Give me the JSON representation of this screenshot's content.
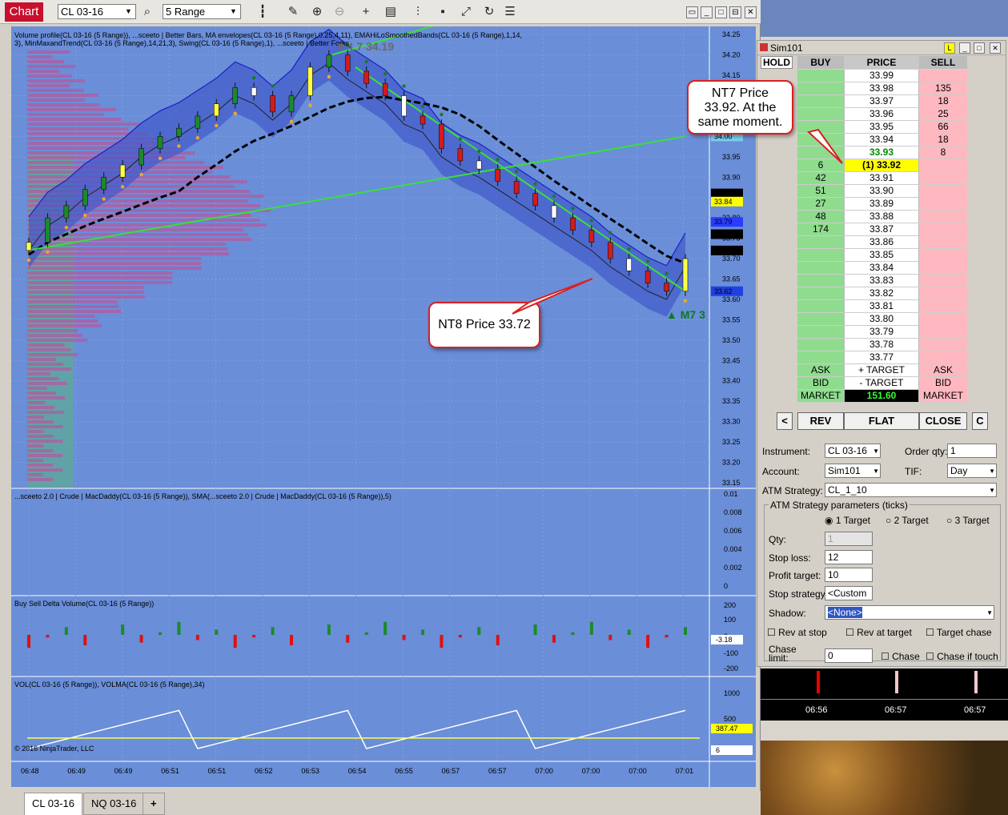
{
  "toolbar": {
    "chart_tab": "Chart",
    "instrument": "CL 03-16",
    "period": "5 Range"
  },
  "chart_data": {
    "type": "candlestick",
    "panels": [
      {
        "title": "Volume profile(CL 03-16 (5 Range)), ...sceeto | Better Bars, MA envelopes(CL 03-16 (5 Range),0.25,4,11), EMAHiLoSmoothedBands(CL 03-16 (5 Range),1,14,3), MinMaxandTrend(CL 03-16 (5 Range),14,21,3), Swing(CL 03-16 (5 Range),1), ...sceeto | Better Forks",
        "y_ticks": [
          "34.25",
          "34.20",
          "34.15",
          "34.10",
          "34.05",
          "34.00",
          "33.95",
          "33.90",
          "33.85",
          "33.80",
          "33.75",
          "33.70",
          "33.65",
          "33.60",
          "33.55",
          "33.50",
          "33.45",
          "33.40",
          "33.35",
          "33.30",
          "33.25",
          "33.20",
          "33.15"
        ],
        "price_flags": [
          "34.00",
          "33.86",
          "33.84",
          "33.79",
          "33.76",
          "33.72",
          "33.62"
        ],
        "annotations": [
          "L7  34.19",
          "M7  3"
        ]
      },
      {
        "title": "...sceeto 2.0 | Crude | MacDaddy(CL 03-16 (5 Range)), SMA(...sceeto 2.0 | Crude | MacDaddy(CL 03-16 (5 Range)),5)",
        "y_ticks": [
          "0.01",
          "0.008",
          "0.006",
          "0.004",
          "0.002",
          "0"
        ]
      },
      {
        "title": "Buy Sell Delta Volume(CL 03-16 (5 Range))",
        "y_ticks": [
          "200",
          "100",
          "0",
          "-100",
          "-200"
        ],
        "flag": "-3.18"
      },
      {
        "title": "VOL(CL 03-16 (5 Range)), VOLMA(CL 03-16 (5 Range),34)",
        "y_ticks": [
          "1000",
          "500"
        ],
        "flags": [
          "387.47",
          "6"
        ],
        "copyright": "© 2016 NinjaTrader, LLC"
      }
    ],
    "x_ticks": [
      "06:48",
      "06:49",
      "06:49",
      "06:51",
      "06:51",
      "06:52",
      "06:53",
      "06:54",
      "06:55",
      "06:57",
      "06:57",
      "07:00",
      "07:00",
      "07:00",
      "07:01"
    ],
    "candles": [
      33.74,
      33.8,
      33.83,
      33.87,
      33.9,
      33.93,
      33.97,
      34.0,
      34.02,
      34.05,
      34.08,
      34.12,
      34.1,
      34.06,
      34.1,
      34.17,
      34.2,
      34.16,
      34.13,
      34.1,
      34.05,
      34.03,
      33.97,
      33.94,
      33.92,
      33.89,
      33.86,
      33.83,
      33.8,
      33.77,
      33.74,
      33.7,
      33.67,
      33.64,
      33.62,
      33.7
    ]
  },
  "callouts": {
    "nt8": "NT8 Price 33.72",
    "nt7_1": "NT7 Price",
    "nt7_2": "33.92.  At the",
    "nt7_3": "same moment."
  },
  "bottom_tabs": [
    "CL 03-16",
    "NQ 03-16",
    "+"
  ],
  "sim": {
    "title": "Sim101",
    "headers": {
      "hold": "HOLD",
      "buy": "BUY",
      "price": "PRICE",
      "sell": "SELL"
    },
    "rows": [
      {
        "buy": "",
        "price": "33.99",
        "sell": ""
      },
      {
        "buy": "",
        "price": "33.98",
        "sell": "135"
      },
      {
        "buy": "",
        "price": "33.97",
        "sell": "18"
      },
      {
        "buy": "",
        "price": "33.96",
        "sell": "25"
      },
      {
        "buy": "",
        "price": "33.95",
        "sell": "66"
      },
      {
        "buy": "",
        "price": "33.94",
        "sell": "18"
      },
      {
        "buy": "",
        "price": "33.93",
        "sell": "8"
      },
      {
        "buy": "6",
        "price": "(1) 33.92",
        "sell": ""
      },
      {
        "buy": "42",
        "price": "33.91",
        "sell": ""
      },
      {
        "buy": "51",
        "price": "33.90",
        "sell": ""
      },
      {
        "buy": "27",
        "price": "33.89",
        "sell": ""
      },
      {
        "buy": "48",
        "price": "33.88",
        "sell": ""
      },
      {
        "buy": "174",
        "price": "33.87",
        "sell": ""
      },
      {
        "buy": "",
        "price": "33.86",
        "sell": ""
      },
      {
        "buy": "",
        "price": "33.85",
        "sell": ""
      },
      {
        "buy": "",
        "price": "33.84",
        "sell": ""
      },
      {
        "buy": "",
        "price": "33.83",
        "sell": ""
      },
      {
        "buy": "",
        "price": "33.82",
        "sell": ""
      },
      {
        "buy": "",
        "price": "33.81",
        "sell": ""
      },
      {
        "buy": "",
        "price": "33.80",
        "sell": ""
      },
      {
        "buy": "",
        "price": "33.79",
        "sell": ""
      },
      {
        "buy": "",
        "price": "33.78",
        "sell": ""
      },
      {
        "buy": "",
        "price": "33.77",
        "sell": ""
      },
      {
        "buy": "ASK",
        "price": "+ TARGET",
        "sell": "ASK"
      },
      {
        "buy": "BID",
        "price": "- TARGET",
        "sell": "BID"
      },
      {
        "buy": "MARKET",
        "price": "151.60",
        "sell": "MARKET"
      }
    ],
    "buttons": {
      "left": "<",
      "rev": "REV",
      "flat": "FLAT",
      "close": "CLOSE",
      "right": "C"
    },
    "labels": {
      "instrument": "Instrument:",
      "order_qty": "Order qty:",
      "account": "Account:",
      "tif": "TIF:",
      "atm": "ATM Strategy:",
      "atm_params": "ATM Strategy parameters (ticks)",
      "t1": "1 Target",
      "t2": "2 Target",
      "t3": "3 Target",
      "qty": "Qty:",
      "stop_loss": "Stop loss:",
      "profit_target": "Profit target:",
      "stop_strategy": "Stop strategy:",
      "shadow": "Shadow:",
      "rev_stop": "Rev at stop",
      "rev_target": "Rev at target",
      "target_chase": "Target chase",
      "chase_limit": "Chase limit:",
      "chase": "Chase",
      "chase_touch": "Chase if touch"
    },
    "values": {
      "instrument": "CL 03-16",
      "order_qty": "1",
      "account": "Sim101",
      "tif": "Day",
      "atm": "CL_1_10",
      "qty": "1",
      "stop_loss": "12",
      "profit_target": "10",
      "stop_strategy": "<Custom",
      "shadow": "<None>",
      "chase_limit": "0"
    }
  },
  "time_axis": [
    "06:56",
    "06:57",
    "06:57"
  ]
}
